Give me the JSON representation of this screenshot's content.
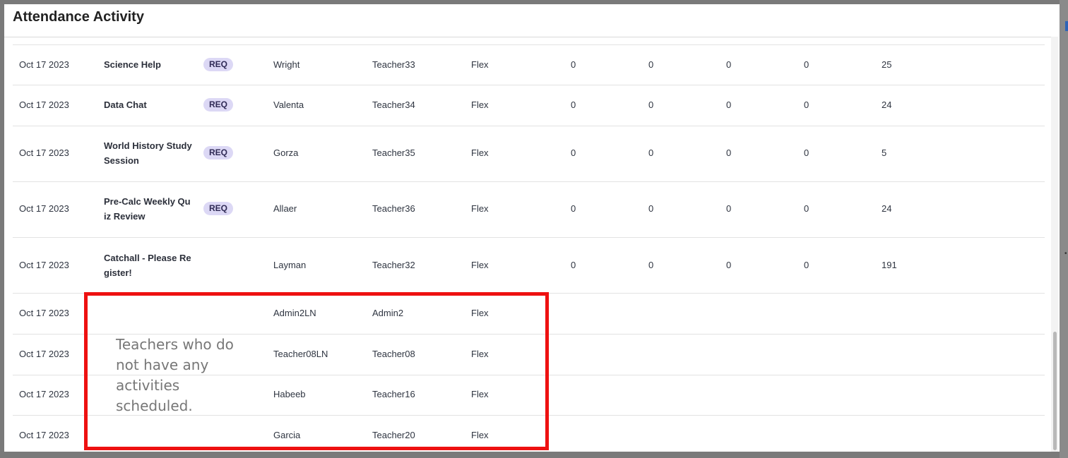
{
  "panel": {
    "title": "Attendance Activity"
  },
  "rows": [
    {
      "date": "Oct 17 2023",
      "activity": "Science Help",
      "req": "REQ",
      "last": "Wright",
      "teacher": "Teacher33",
      "type": "Flex",
      "n1": "0",
      "n2": "0",
      "n3": "0",
      "n4": "0",
      "n5": "25"
    },
    {
      "date": "Oct 17 2023",
      "activity": "Data Chat",
      "req": "REQ",
      "last": "Valenta",
      "teacher": "Teacher34",
      "type": "Flex",
      "n1": "0",
      "n2": "0",
      "n3": "0",
      "n4": "0",
      "n5": "24"
    },
    {
      "date": "Oct 17 2023",
      "activity": "World History Study Session",
      "req": "REQ",
      "last": "Gorza",
      "teacher": "Teacher35",
      "type": "Flex",
      "n1": "0",
      "n2": "0",
      "n3": "0",
      "n4": "0",
      "n5": "5"
    },
    {
      "date": "Oct 17 2023",
      "activity": "Pre-Calc Weekly Quiz Review",
      "req": "REQ",
      "last": "Allaer",
      "teacher": "Teacher36",
      "type": "Flex",
      "n1": "0",
      "n2": "0",
      "n3": "0",
      "n4": "0",
      "n5": "24"
    },
    {
      "date": "Oct 17 2023",
      "activity": "Catchall - Please Register!",
      "req": "",
      "last": "Layman",
      "teacher": "Teacher32",
      "type": "Flex",
      "n1": "0",
      "n2": "0",
      "n3": "0",
      "n4": "0",
      "n5": "191"
    },
    {
      "date": "Oct 17 2023",
      "last": "Admin2LN",
      "teacher": "Admin2",
      "type": "Flex"
    },
    {
      "date": "Oct 17 2023",
      "last": "Teacher08LN",
      "teacher": "Teacher08",
      "type": "Flex"
    },
    {
      "date": "Oct 17 2023",
      "last": "Habeeb",
      "teacher": "Teacher16",
      "type": "Flex"
    },
    {
      "date": "Oct 17 2023",
      "last": "Garcia",
      "teacher": "Teacher20",
      "type": "Flex"
    }
  ],
  "annotation": {
    "text": "Teachers who do not have any activities scheduled.",
    "color": "#ee1111"
  }
}
